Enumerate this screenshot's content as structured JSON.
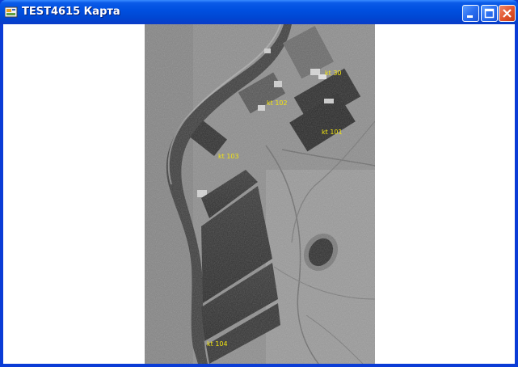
{
  "window": {
    "title": "TEST4615 Карта",
    "icon": "app-icon",
    "buttons": {
      "minimize": "minimize-icon",
      "maximize": "maximize-icon",
      "close": "close-icon"
    }
  },
  "map": {
    "image": "satellite-image",
    "marker_color": "#f2e410",
    "markers": [
      {
        "label": "kt 30"
      },
      {
        "label": "kt 102"
      },
      {
        "label": "kt 101"
      },
      {
        "label": "kt 103"
      },
      {
        "label": "kt 104"
      }
    ]
  }
}
